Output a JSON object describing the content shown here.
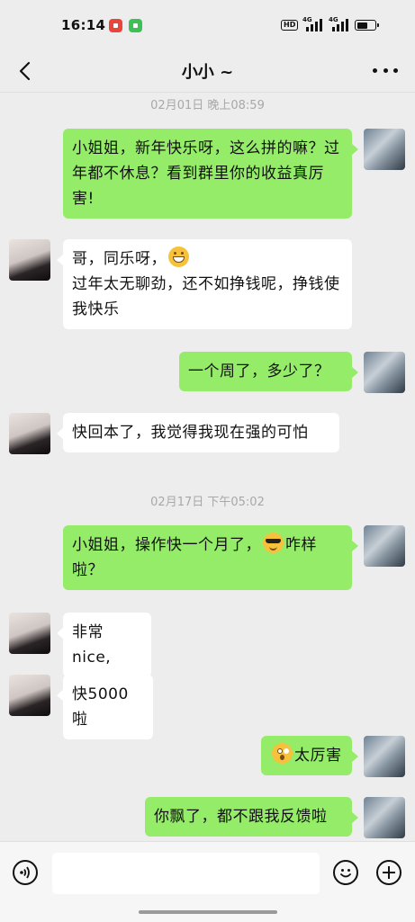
{
  "status_bar": {
    "time": "16:14",
    "hd_label": "HD",
    "network_1": "4G",
    "network_2": "4G",
    "battery_level": 0.7
  },
  "header": {
    "title": "小小 ~"
  },
  "messages": [
    {
      "kind": "time",
      "text": "02月01日 晚上08:59"
    },
    {
      "kind": "me",
      "text": "小姐姐，新年快乐呀，这么拼的嘛？过年都不休息？看到群里你的收益真厉害!"
    },
    {
      "kind": "her",
      "line1": "哥，同乐呀，",
      "line1_emoji": "grinning-face-emoji",
      "line2": "过年太无聊劲，还不如挣钱呢，挣钱使我快乐"
    },
    {
      "kind": "me",
      "text": "一个周了，多少了？"
    },
    {
      "kind": "her",
      "text": "快回本了，我觉得我现在强的可怕"
    },
    {
      "kind": "time",
      "text": "02月17日 下午05:02"
    },
    {
      "kind": "me",
      "text_before": "小姐姐，操作快一个月了，",
      "emoji": "sunglasses-face-emoji",
      "text_after": "咋样啦？"
    },
    {
      "kind": "her",
      "text": "非常nice,"
    },
    {
      "kind": "her",
      "text": "快5000啦"
    },
    {
      "kind": "me",
      "emoji": "astonished-face-emoji",
      "text": "太厉害"
    },
    {
      "kind": "me",
      "text": "你飘了，都不跟我反馈啦"
    }
  ],
  "input_bar": {
    "placeholder": ""
  },
  "colors": {
    "background": "#ededed",
    "my_bubble": "#95ec69",
    "her_bubble": "#ffffff",
    "timestamp": "#a8a8a8"
  },
  "icons": [
    "back-arrow-icon",
    "more-dots-icon",
    "voice-icon",
    "smile-icon",
    "plus-icon"
  ]
}
